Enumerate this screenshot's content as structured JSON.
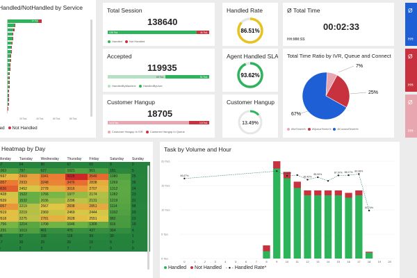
{
  "service_card": {
    "title": "Handled/NotHandled by Service",
    "axis_ticks": [
      "20 Tsd.",
      "40 Tsd.",
      "60 Tsd.",
      "80 Tsd."
    ],
    "top_bar_label": "37 Tsd.",
    "legend": [
      {
        "label": "led",
        "color": "#2db45a"
      },
      {
        "label": "Not Handled",
        "color": "#c8323e"
      }
    ],
    "bar_values": [
      37,
      8,
      7,
      6,
      5.5,
      5,
      4.5,
      4,
      3.5,
      3,
      2.5,
      2.2,
      2,
      1.8,
      1.6,
      1.4,
      1.2,
      1,
      0.8,
      0.6,
      0.4
    ],
    "bar_nh": [
      4,
      1,
      1,
      1,
      0.5,
      0.5,
      0.5,
      0.5,
      0.5,
      0.3,
      0.3,
      0.3,
      0.2,
      0.2,
      0.2,
      0.2,
      0.1,
      0.1,
      0.1,
      0.1,
      0.1
    ],
    "row_labels": [
      "",
      "m",
      "",
      "",
      "",
      "",
      "",
      "",
      "",
      "",
      "",
      "",
      "",
      "",
      "",
      "",
      "",
      "",
      "",
      "",
      ""
    ]
  },
  "total_session": {
    "title": "Total Session",
    "value": "138640",
    "bar_left": "135 Tsd.",
    "bar_right": "4k Tsd.",
    "handled_fraction": 0.9,
    "legend": [
      {
        "label": "Handled",
        "color": "#2db45a"
      },
      {
        "label": "Not Handled",
        "color": "#c8323e"
      }
    ]
  },
  "accepted": {
    "title": "Accepted",
    "value": "119935",
    "bar_left": "69 Tsd.",
    "bar_right": "51 Tsd.",
    "machine_fraction": 0.57,
    "legend": [
      {
        "label": "HandledByMachine",
        "color": "#b5e0c4"
      },
      {
        "label": "HandledByUser",
        "color": "#2db45a"
      }
    ]
  },
  "customer_hangup_card": {
    "title": "Customer Hangup",
    "value": "18705",
    "bar_left": "14.8 Tsd.",
    "bar_right": "3.8 Tsd.",
    "ivr_fraction": 0.8,
    "legend": [
      {
        "label": "Customer Hangup In IVR",
        "color": "#e8a6b0"
      },
      {
        "label": "Customer Hangup In Queue",
        "color": "#c8323e"
      }
    ]
  },
  "handled_rate": {
    "title": "Handled Rate",
    "value": "86.51%",
    "fraction": 0.8651,
    "color": "#e8c31d"
  },
  "agent_sla": {
    "title": "Agent Handled SLA",
    "value": "93.62%",
    "fraction": 0.9362,
    "color": "#2db45a"
  },
  "customer_hangup_gauge": {
    "title": "Customer Hangup",
    "value": "13.49%",
    "fraction": 0.1349,
    "color": "#2db45a"
  },
  "total_time": {
    "title": "Ø Total Time",
    "value": "00:02:33",
    "format": "HH:MM:SS"
  },
  "ratio_card": {
    "title": "Total Time Ratio by IVR, Queue and Connect",
    "slices": [
      {
        "label": "67%",
        "value": 67,
        "color": "#1f5fd6"
      },
      {
        "label": "7%",
        "value": 7,
        "color": "#e8a6b0"
      },
      {
        "label": "25%",
        "value": 25,
        "color": "#c8323e"
      }
    ],
    "legend": [
      {
        "label": "ØIvrTimeIn%",
        "color": "#e8a6b0"
      },
      {
        "label": "ØQueueTimeIn%",
        "color": "#c8323e"
      },
      {
        "label": "ØConnectTimeIn%",
        "color": "#1f5fd6"
      }
    ]
  },
  "right_tiles": [
    {
      "title": "Ø",
      "format": "HH:",
      "color": "#1f5fd6"
    },
    {
      "title": "Ø",
      "format": "HH:",
      "color": "#c8323e"
    },
    {
      "title": "Ø",
      "format": "HH:",
      "color": "#e8a6b0"
    }
  ],
  "heatmap": {
    "title": "Heatmap by Day",
    "columns": [
      "Monday",
      "Tuesday",
      "Wednesday",
      "Thursday",
      "Friday",
      "Saturday",
      "Sunday"
    ],
    "rows": [
      [
        67,
        64,
        80,
        67,
        65,
        8,
        0
      ],
      [
        1063,
        797,
        627,
        1021,
        901,
        181,
        5
      ],
      [
        2697,
        2969,
        3341,
        4228,
        3540,
        1080,
        25
      ],
      [
        3357,
        2933,
        3248,
        3476,
        2838,
        1269,
        36
      ],
      [
        3636,
        2452,
        2778,
        3016,
        2707,
        1312,
        24
      ],
      [
        2428,
        1522,
        1766,
        1977,
        2174,
        1282,
        23
      ],
      [
        2639,
        1532,
        2036,
        2296,
        2131,
        1219,
        31
      ],
      [
        3057,
        2219,
        2567,
        2838,
        2851,
        1114,
        88
      ],
      [
        2619,
        2219,
        2369,
        2469,
        2444,
        1032,
        29
      ],
      [
        2618,
        2275,
        2781,
        2628,
        2551,
        882,
        23
      ],
      [
        1756,
        1214,
        1708,
        1646,
        1305,
        816,
        18
      ],
      [
        1231,
        1013,
        401,
        476,
        437,
        364,
        4
      ],
      [
        96,
        87,
        106,
        118,
        99,
        30,
        1
      ],
      [
        17,
        30,
        25,
        26,
        16,
        6,
        0
      ],
      [
        4,
        2,
        5,
        7,
        7,
        0,
        0
      ]
    ]
  },
  "volume_card": {
    "title": "Task by Volume and Hour",
    "legend": [
      {
        "label": "Handled",
        "color": "#2db45a"
      },
      {
        "label": "Not Handled",
        "color": "#c8323e"
      },
      {
        "label": "Handled Rate*",
        "color": "#222222"
      }
    ]
  },
  "chart_data": {
    "type": "bar",
    "stacked": true,
    "categories": [
      "0",
      "1",
      "2",
      "3",
      "4",
      "5",
      "6",
      "7",
      "8",
      "9",
      "10",
      "11",
      "12",
      "13",
      "14",
      "15",
      "16",
      "17",
      "18",
      "19",
      "20"
    ],
    "series": [
      {
        "name": "Handled",
        "values": [
          0,
          0,
          0,
          0,
          0,
          0,
          0,
          0,
          1.5,
          18.5,
          16.5,
          14.5,
          13,
          13,
          13,
          13,
          12.5,
          13,
          1.2,
          0,
          0
        ]
      },
      {
        "name": "Not Handled",
        "values": [
          0,
          0,
          0,
          0,
          0,
          0,
          0,
          0,
          1.2,
          1.5,
          1.3,
          1.3,
          1,
          1,
          1,
          1,
          1,
          1,
          0.2,
          0,
          0
        ]
      },
      {
        "name": "Handled Rate*",
        "values": [
          84.67,
          null,
          null,
          null,
          null,
          null,
          null,
          null,
          null,
          92.5,
          87.54,
          88.3,
          83.42,
          85.99,
          82.17,
          87.97,
          88.17,
          89.38,
          50.74,
          null,
          null
        ]
      }
    ],
    "rate_labels": [
      "84.67%",
      "",
      "",
      "",
      "",
      "",
      "",
      "",
      "",
      "",
      "87.54%",
      "",
      "83.42%",
      "85.99%",
      "",
      "87.97%",
      "88.17%",
      "89.38%",
      "50.74%",
      "",
      ""
    ],
    "y_ticks": [
      "0 Tsd.",
      "5 Tsd.",
      "10 Tsd.",
      "15 Tsd.",
      "20 Tsd."
    ],
    "ylim": [
      0,
      20
    ],
    "xlabel": "",
    "ylabel": ""
  }
}
